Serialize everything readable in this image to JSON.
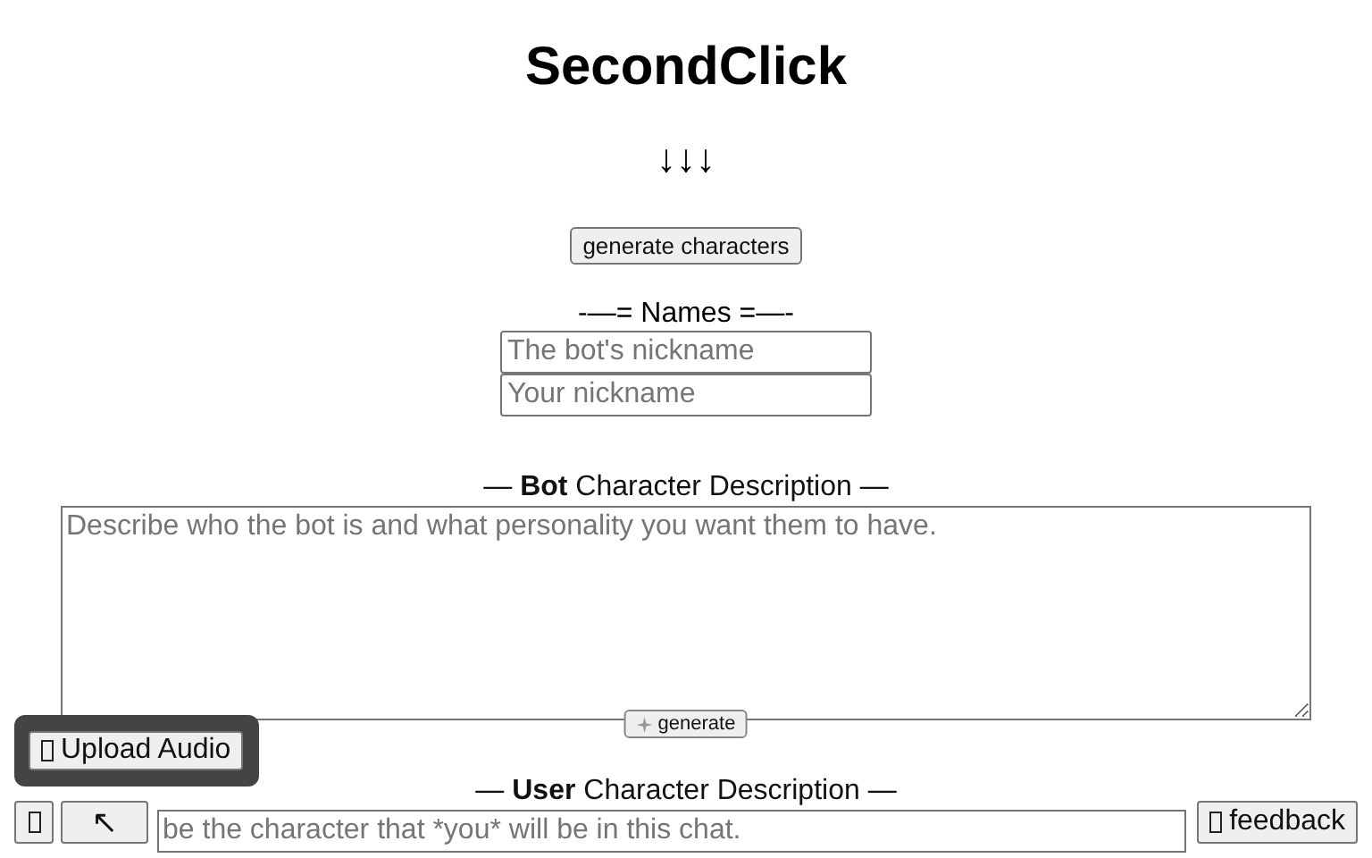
{
  "title": "SecondClick",
  "arrows": "↓↓↓",
  "generate_characters_button": "generate characters",
  "names": {
    "heading": "-—= Names =—-",
    "fields": [
      {
        "placeholder": "The bot's nickname"
      },
      {
        "placeholder": "Your nickname"
      }
    ]
  },
  "descriptions": [
    {
      "heading": "— **Bot** Character Description —",
      "placeholder": "Describe who the bot is and what personality you want them to have.",
      "generate_button": "generate"
    },
    {
      "heading": "— **User** Character Description —",
      "placeholder": "be the character that *you* will be in this chat."
    }
  ],
  "upload_audio_button": "Upload Audio",
  "expand_button": "↖",
  "feedback_button": "feedback"
}
